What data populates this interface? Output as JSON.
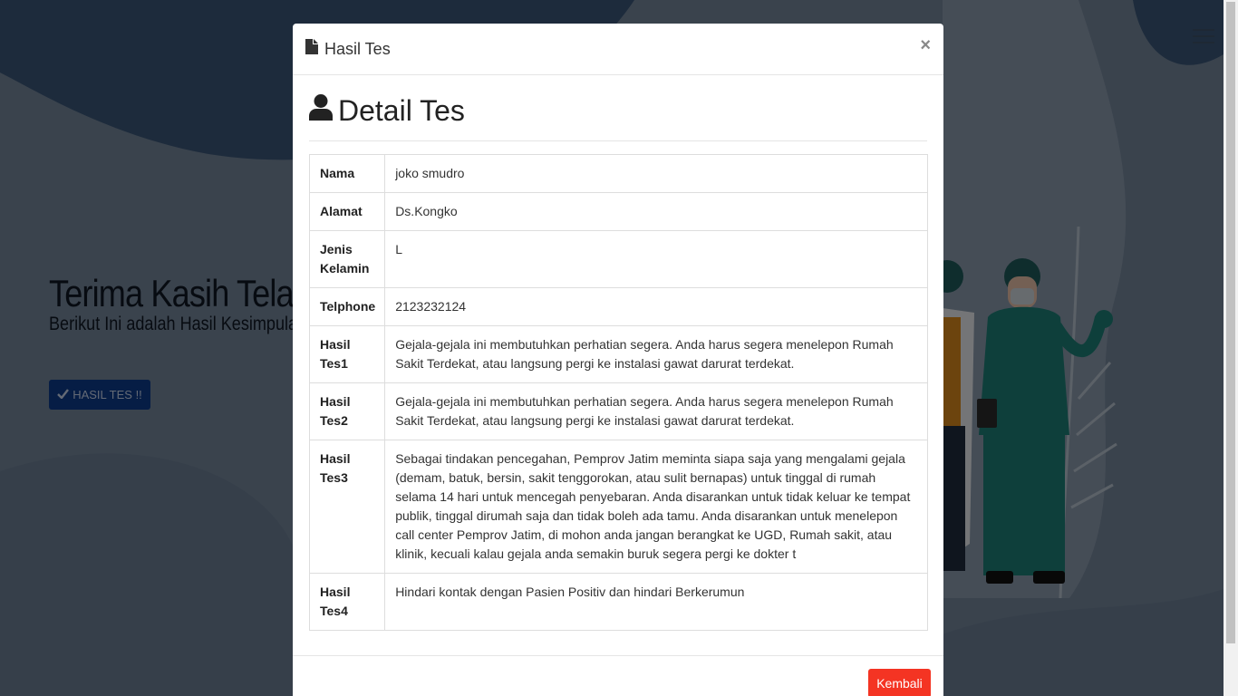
{
  "background": {
    "hero_title": "Terima Kasih Telah",
    "hero_subtitle": "Berikut Ini adalah Hasil Kesimpulan",
    "hero_button_label": "HASIL TES !!",
    "colors": {
      "page": "#3a4e65",
      "button": "#0c3a8a"
    }
  },
  "modal": {
    "title": "Hasil Tes",
    "close_symbol": "×",
    "heading": "Detail Tes",
    "rows": [
      {
        "label": "Nama",
        "value": "joko smudro"
      },
      {
        "label": "Alamat",
        "value": "Ds.Kongko"
      },
      {
        "label": "Jenis Kelamin",
        "value": "L"
      },
      {
        "label": "Telphone",
        "value": "2123232124"
      },
      {
        "label": "Hasil Tes1",
        "value": "Gejala-gejala ini membutuhkan perhatian segera. Anda harus segera menelepon Rumah Sakit Terdekat, atau langsung pergi ke instalasi gawat darurat terdekat."
      },
      {
        "label": "Hasil Tes2",
        "value": "Gejala-gejala ini membutuhkan perhatian segera. Anda harus segera menelepon Rumah Sakit Terdekat, atau langsung pergi ke instalasi gawat darurat terdekat."
      },
      {
        "label": "Hasil Tes3",
        "value": "Sebagai tindakan pencegahan, Pemprov Jatim meminta siapa saja yang mengalami gejala (demam, batuk, bersin, sakit tenggorokan, atau sulit bernapas) untuk tinggal di rumah selama 14 hari untuk mencegah penyebaran. Anda disarankan untuk tidak keluar ke tempat publik, tinggal dirumah saja dan tidak boleh ada tamu. Anda disarankan untuk menelepon call center Pemprov Jatim, di mohon anda jangan berangkat ke UGD, Rumah sakit, atau klinik, kecuali kalau gejala anda semakin buruk segera pergi ke dokter t"
      },
      {
        "label": "Hasil Tes4",
        "value": "Hindari kontak dengan Pasien Positiv dan hindari Berkerumun"
      }
    ],
    "footer_button_label": "Kembali",
    "colors": {
      "kembali": "#f43423"
    },
    "icons": {
      "title": "file-icon",
      "heading": "user-icon"
    }
  }
}
